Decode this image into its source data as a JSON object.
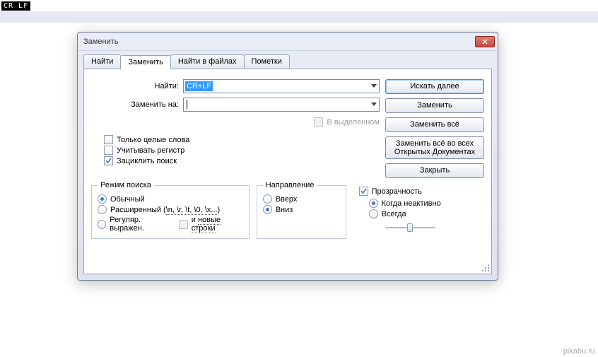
{
  "top_badge": "CR LF",
  "dialog": {
    "title": "Заменить",
    "tabs": [
      "Найти",
      "Заменить",
      "Найти в файлах",
      "Пометки"
    ],
    "active_tab": 1,
    "find_label": "Найти:",
    "find_value": "CR+LF",
    "replace_label": "Заменить на:",
    "replace_value": "",
    "in_selection_label": "В выделенном",
    "buttons": {
      "find_next": "Искать далее",
      "replace": "Заменить",
      "replace_all": "Заменить всё",
      "replace_all_docs": "Заменить всё во всех Открытых Документах",
      "close": "Закрыть"
    },
    "checks": {
      "whole_word": "Только целые слова",
      "match_case": "Учитывать регистр",
      "wrap": "Зациклить поиск"
    },
    "search_mode": {
      "title": "Режим поиска",
      "normal": "Обычный",
      "extended_a": "Расширенный (",
      "extended_b": "\\n, \\r, \\t, \\0, \\x...",
      "extended_c": ")",
      "regex": "Регуляр. выражен.",
      "and_newlines": "и новые строки"
    },
    "direction": {
      "title": "Направление",
      "up": "Вверх",
      "down": "Вниз"
    },
    "transparency": {
      "title": "Прозрачность",
      "inactive": "Когда неактивно",
      "always": "Всегда"
    }
  },
  "watermark": "pikabu.ru"
}
